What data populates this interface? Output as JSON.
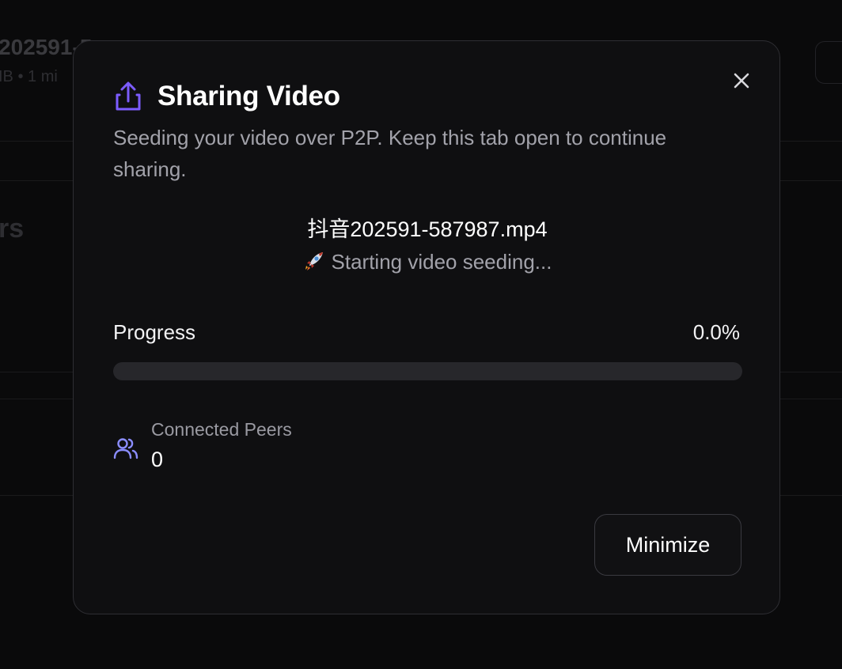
{
  "background": {
    "file_title": "202591-5",
    "file_meta": "IB • 1 mi",
    "section_heading": "rs"
  },
  "modal": {
    "title": "Sharing Video",
    "title_icon": "share-upload-icon",
    "description": "Seeding your video over P2P. Keep this tab open to continue sharing.",
    "close_icon": "close-icon",
    "file_name": "抖音202591-587987.mp4",
    "status_icon": "rocket-emoji",
    "status_text": "Starting video seeding...",
    "progress": {
      "label": "Progress",
      "value_text": "0.0%",
      "fraction": 0.0
    },
    "peers": {
      "icon": "users-icon",
      "label": "Connected Peers",
      "value": "0"
    },
    "minimize_label": "Minimize",
    "colors": {
      "accent_purple": "#7c5cff",
      "peers_icon_blue": "#8b8dff"
    }
  }
}
